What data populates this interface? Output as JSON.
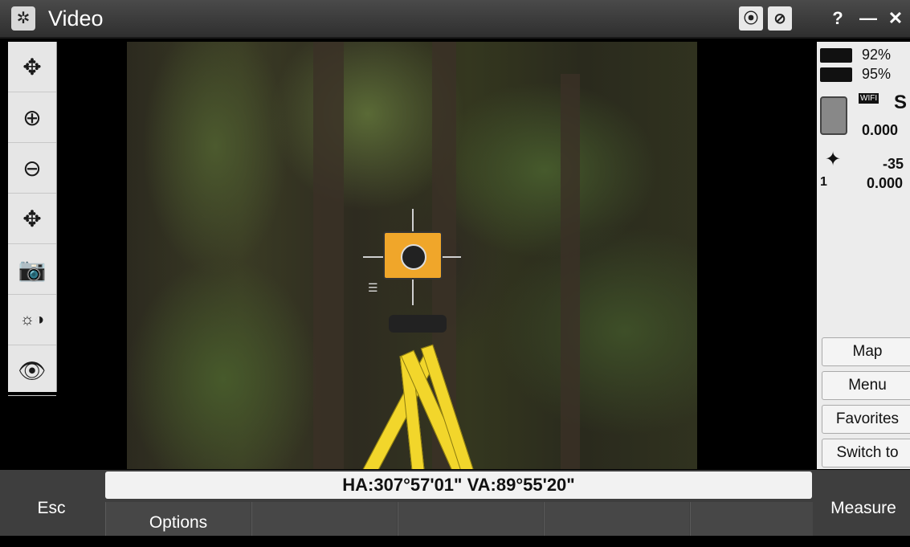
{
  "window": {
    "title": "Video",
    "help_label": "?",
    "minimize_label": "—",
    "close_label": "✕"
  },
  "toolbar": [
    {
      "icon": "pan-zoom-icon",
      "glyph": "✥"
    },
    {
      "icon": "zoom-in-icon",
      "glyph": "⊕"
    },
    {
      "icon": "zoom-out-icon",
      "glyph": "⊖"
    },
    {
      "icon": "pan-icon",
      "glyph": "✥"
    },
    {
      "icon": "camera-icon",
      "glyph": "📷"
    },
    {
      "icon": "brightness-contrast-icon",
      "glyph": "☼◑"
    },
    {
      "icon": "eye-icon",
      "glyph": "👁"
    }
  ],
  "status": {
    "battery1": "92%",
    "battery2": "95%",
    "wifi_label": "WIFI",
    "instrument_letter": "S",
    "instrument_value": "0.000",
    "target_number": "1",
    "target_offset": "-35",
    "target_value": "0.000"
  },
  "side_buttons": {
    "map": "Map",
    "menu": "Menu",
    "favorites": "Favorites",
    "switch_to": "Switch to"
  },
  "angles": "HA:307°57'01\"  VA:89°55'20\"",
  "bottom": {
    "esc": "Esc",
    "options": "Options",
    "measure": "Measure"
  }
}
